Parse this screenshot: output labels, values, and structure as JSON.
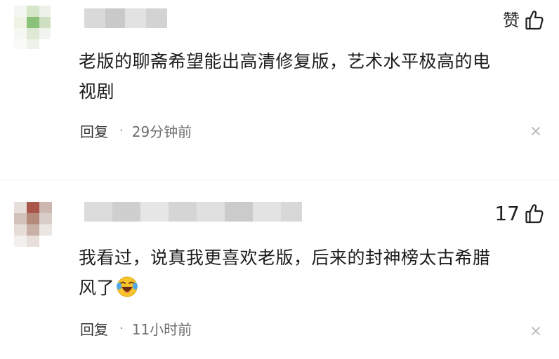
{
  "comments": [
    {
      "like_label": "赞",
      "line1": "老版的聊斋希望能出高清修复版，艺术水平极高的电",
      "line2": "视剧",
      "reply_label": "回复",
      "separator": "·",
      "time": "29分钟前"
    },
    {
      "like_count": "17",
      "line1": "我看过，说真我更喜欢老版，后来的封神榜太古希腊",
      "line2": "风了",
      "emoji": "laughing-crying-emoji",
      "reply_label": "回复",
      "separator": "·",
      "time": "11小时前"
    }
  ],
  "icons": {
    "like": "thumbs-up-icon",
    "close": "close-icon"
  },
  "colors": {
    "text": "#1c1c1c",
    "meta": "#6e6e6e",
    "icon": "#1f1f1f",
    "close": "#b5b5b5"
  }
}
